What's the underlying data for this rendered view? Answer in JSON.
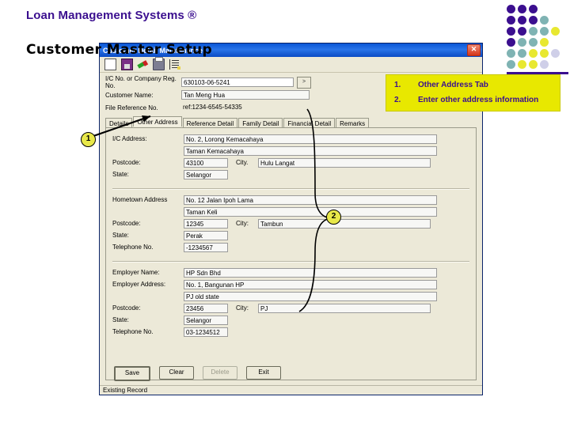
{
  "slide": {
    "title": "Loan Management Systems ®",
    "subtitle": "Customer Master Setup"
  },
  "window": {
    "title": "Customer Detail Maintenance",
    "close_label": "✕",
    "toolbar_icons": [
      "new-document-icon",
      "save-icon",
      "edit-icon",
      "print-icon",
      "list-icon"
    ]
  },
  "header_fields": [
    {
      "label": "I/C No. or Company Reg. No.",
      "value": "630103-06-5241"
    },
    {
      "label": "Customer Name:",
      "value": "Tan Meng Hua"
    },
    {
      "label": "File Reference No.",
      "value": "ref:1234-6545-54335"
    }
  ],
  "lookup_button_label": ">",
  "tabs": [
    {
      "label": "Details",
      "active": false
    },
    {
      "label": "Other Address",
      "active": true
    },
    {
      "label": "Reference Detail",
      "active": false
    },
    {
      "label": "Family Detail",
      "active": false
    },
    {
      "label": "Financial Detail",
      "active": false
    },
    {
      "label": "Remarks",
      "active": false
    }
  ],
  "sections": {
    "ic_address": {
      "label": "I/C Address:",
      "line1": "No. 2, Lorong Kemacahaya",
      "line2": "Taman Kemacahaya",
      "postcode_label": "Postcode:",
      "postcode": "43100",
      "city_label": "City.",
      "city": "Hulu Langat",
      "state_label": "State:",
      "state": "Selangor"
    },
    "hometown_address": {
      "label": "Hometown Address",
      "line1": "No. 12 Jalan Ipoh Lama",
      "line2": "Taman Keli",
      "postcode_label": "Postcode:",
      "postcode": "12345",
      "city_label": "City:",
      "city": "Tambun",
      "state_label": "State:",
      "state": "Perak",
      "telephone_label": "Telephone No.",
      "telephone": "-1234567"
    },
    "employer": {
      "name_label": "Employer Name:",
      "name": "HP Sdn Bhd",
      "address_label": "Employer Address:",
      "line1": "No. 1, Bangunan HP",
      "line2": "PJ old state",
      "postcode_label": "Postcode:",
      "postcode": "23456",
      "city_label": "City:",
      "city": "PJ",
      "state_label": "State:",
      "state": "Selangor",
      "telephone_label": "Telephone No.",
      "telephone": "03-1234512"
    }
  },
  "buttons": {
    "save": "Save",
    "clear": "Clear",
    "delete": "Delete",
    "exit": "Exit"
  },
  "status": "Existing Record",
  "annotations": {
    "callout": [
      {
        "num": "1.",
        "text": "Other Address Tab"
      },
      {
        "num": "2.",
        "text": "Enter other address information"
      }
    ],
    "markers": [
      {
        "id": "1",
        "label": "1"
      },
      {
        "id": "2",
        "label": "2"
      }
    ]
  },
  "colors": {
    "title_purple": "#3B0F8F",
    "callout_yellow": "#E8E800",
    "marker_yellow": "#E8E84A",
    "titlebar_blue": "#0A56D6",
    "dot_purple": "#3B0F8F",
    "dot_teal": "#7FB3B3",
    "dot_yellow": "#E8E830",
    "dot_lavender": "#CFCFE8"
  },
  "dot_grid": [
    [
      "purple",
      "purple",
      "purple",
      "none",
      "none"
    ],
    [
      "purple",
      "purple",
      "purple",
      "teal",
      "none"
    ],
    [
      "purple",
      "purple",
      "teal",
      "teal",
      "yellow"
    ],
    [
      "purple",
      "teal",
      "teal",
      "yellow",
      "none"
    ],
    [
      "teal",
      "teal",
      "yellow",
      "yellow",
      "lavender"
    ],
    [
      "teal",
      "yellow",
      "yellow",
      "lavender",
      "none"
    ]
  ]
}
